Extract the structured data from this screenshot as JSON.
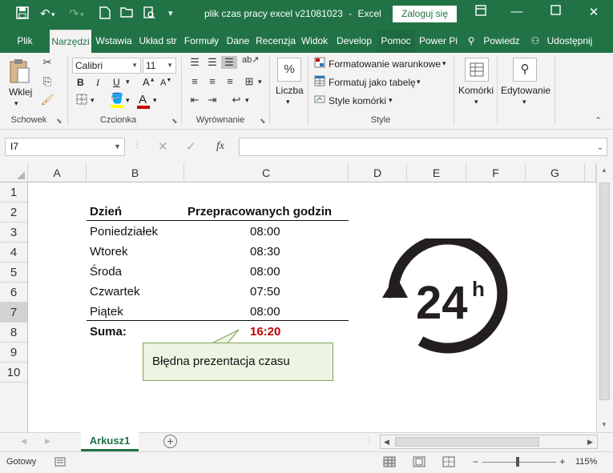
{
  "titlebar": {
    "file_title": "plik czas pracy excel v21081023",
    "separator": "-",
    "app_name": "Excel",
    "signin_label": "Zaloguj się"
  },
  "tabs": [
    {
      "label": "Plik"
    },
    {
      "label": "Narzędzi"
    },
    {
      "label": "Wstawia"
    },
    {
      "label": "Układ str"
    },
    {
      "label": "Formuły"
    },
    {
      "label": "Dane"
    },
    {
      "label": "Recenzja"
    },
    {
      "label": "Widok"
    },
    {
      "label": "Develop"
    },
    {
      "label": "Pomoc"
    },
    {
      "label": "Power Pi"
    }
  ],
  "tellme_label": "Powiedz",
  "share_label": "Udostępnij",
  "ribbon": {
    "clipboard": {
      "paste_label": "Wklej",
      "group_label": "Schowek"
    },
    "font": {
      "name": "Calibri",
      "size": "11",
      "group_label": "Czcionka"
    },
    "alignment": {
      "group_label": "Wyrównanie"
    },
    "number": {
      "label": "Liczba"
    },
    "styles": {
      "conditional_label": "Formatowanie warunkowe",
      "as_table_label": "Formatuj jako tabelę",
      "cell_styles_label": "Style komórki",
      "group_label": "Style"
    },
    "cells": {
      "label": "Komórki"
    },
    "editing": {
      "label": "Edytowanie"
    }
  },
  "formula_bar": {
    "name_box": "I7",
    "fx": "fx",
    "formula": ""
  },
  "columns": [
    "A",
    "B",
    "C",
    "D",
    "E",
    "F",
    "G"
  ],
  "rows": [
    "1",
    "2",
    "3",
    "4",
    "5",
    "6",
    "7",
    "8",
    "9",
    "10"
  ],
  "table": {
    "header_day": "Dzień",
    "header_hours": "Przepracowanych godzin",
    "rows": [
      {
        "day": "Poniedziałek",
        "hours": "08:00"
      },
      {
        "day": "Wtorek",
        "hours": "08:30"
      },
      {
        "day": "Środa",
        "hours": "08:00"
      },
      {
        "day": "Czwartek",
        "hours": "07:50"
      },
      {
        "day": "Piątek",
        "hours": "08:00"
      }
    ],
    "sum_label": "Suma:",
    "sum_value": "16:20"
  },
  "callout_text": "Błędna prezentacja czasu",
  "badge": {
    "number": "24",
    "suffix": "h"
  },
  "sheet_tab": "Arkusz1",
  "status": {
    "ready": "Gotowy",
    "zoom": "115%"
  },
  "colors": {
    "excel_green": "#217346",
    "error_red": "#c00000",
    "callout_fill": "#ecf4e2"
  }
}
